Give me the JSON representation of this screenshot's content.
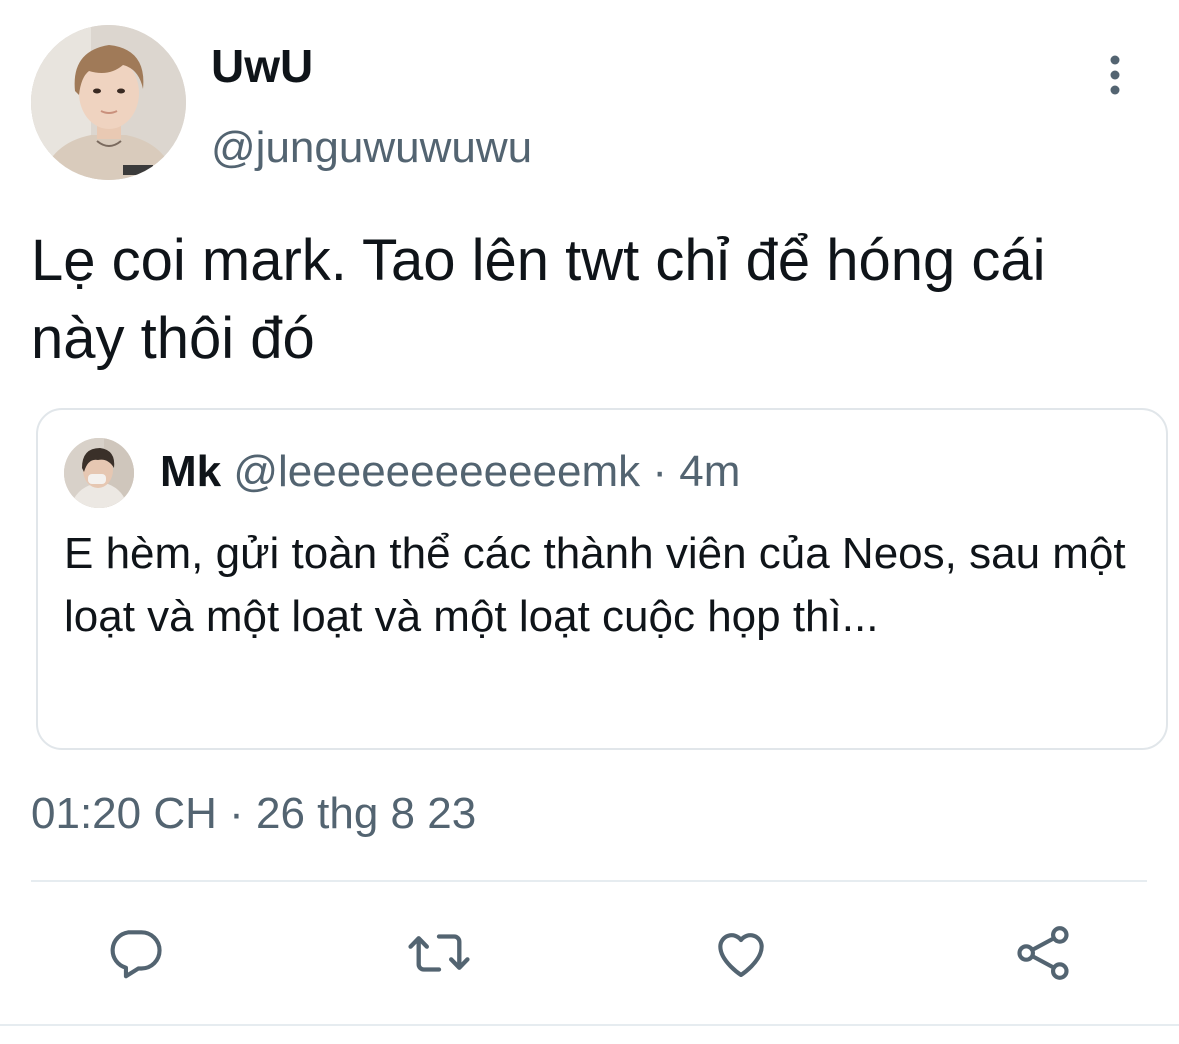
{
  "tweet": {
    "display_name": "UwU",
    "handle": "@junguwuwuwu",
    "text": "Lẹ coi mark. Tao lên twt chỉ để hóng cái này thôi đó",
    "timestamp": "01:20 CH · 26 thg 8 23"
  },
  "quoted_tweet": {
    "display_name": "Mk",
    "handle": "@leeeeeeeeeeeemk",
    "separator": " · ",
    "time_ago": "4m",
    "text": "E hèm, gửi toàn thể các thành viên của Neos, sau một loạt và một loạt và một loạt cuộc họp thì..."
  },
  "actions": [
    {
      "icon": "reply-icon"
    },
    {
      "icon": "retweet-icon"
    },
    {
      "icon": "like-icon"
    },
    {
      "icon": "share-icon"
    }
  ],
  "colors": {
    "text_primary": "#0f1419",
    "text_secondary": "#536471",
    "border": "#e1e6ea"
  }
}
